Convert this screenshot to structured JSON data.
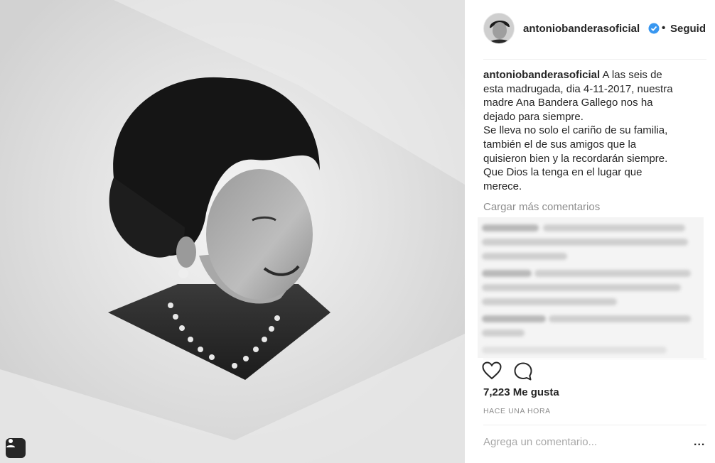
{
  "post": {
    "username": "antoniobanderasoficial",
    "follow_separator": "•",
    "follow_label": "Seguid",
    "caption_lines": [
      "A las seis de",
      "esta madrugada, dia 4-11-2017, nuestra",
      "madre Ana Bandera Gallego nos ha",
      "dejado para siempre.",
      "Se lleva no solo el cariño de su familia,",
      "también el de sus amigos que la",
      "quisieron bien y la recordarán siempre.",
      "Que Dios la tenga en el lugar que",
      "merece."
    ],
    "load_more_label": "Cargar más comentarios",
    "likes": "7,223 Me gusta",
    "timestamp": "HACE UNA HORA",
    "comment_placeholder": "Agrega un comentario...",
    "more_label": "..."
  },
  "icons": {
    "verified": "verified-badge-icon",
    "like": "heart-icon",
    "comment": "comment-bubble-icon",
    "tag": "user-tag-icon"
  },
  "colors": {
    "verified": "#3897f0",
    "muted": "#8e8e8e",
    "text": "#262626"
  }
}
